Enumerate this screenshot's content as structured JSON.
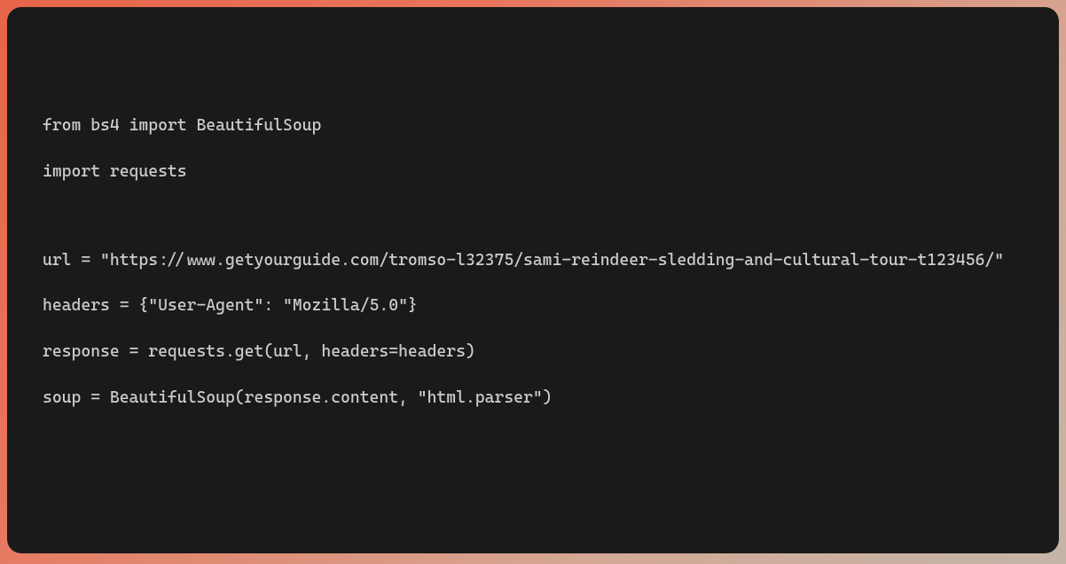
{
  "code": {
    "line1": "from bs4 import BeautifulSoup",
    "line2": "import requests",
    "line3": "url = \"https://www.getyourguide.com/tromso-l32375/sami-reindeer-sledding-and-cultural-tour-t123456/\"",
    "line4": "headers = {\"User-Agent\": \"Mozilla/5.0\"}",
    "line5": "response = requests.get(url, headers=headers)",
    "line6": "soup = BeautifulSoup(response.content, \"html.parser\")"
  }
}
